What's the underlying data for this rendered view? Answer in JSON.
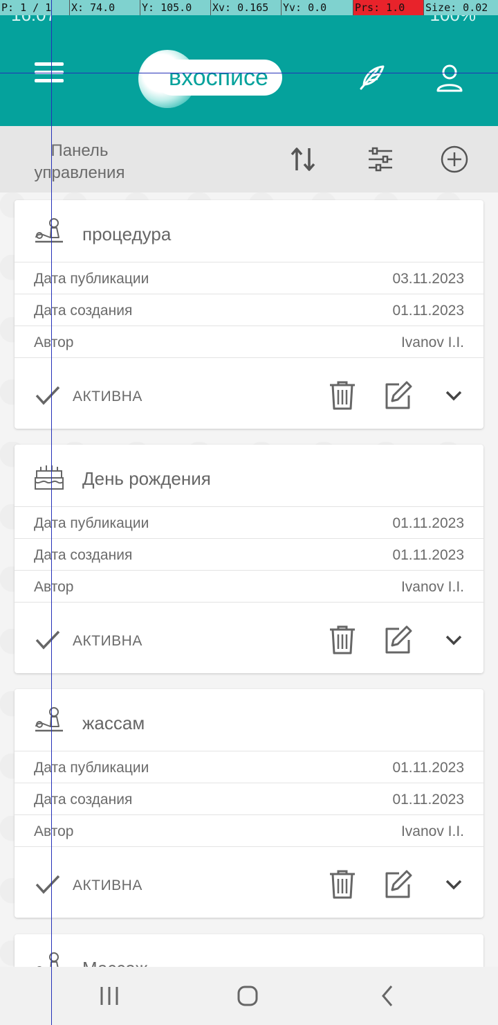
{
  "status_bar": {
    "time": "16:07",
    "battery": "100%",
    "debug": {
      "pointer": "P: 1 / 1",
      "x": "X: 74.0",
      "y": "Y: 105.0",
      "xv": "Xv: 0.165",
      "yv": "Yv: 0.0",
      "prs": "Prs: 1.0",
      "size": "Size: 0.02"
    }
  },
  "header": {
    "logo_text": "вхосписе",
    "icons": [
      "menu-icon",
      "feather-icon",
      "user-icon"
    ]
  },
  "toolbar": {
    "title": "Панель управления",
    "icons": [
      "sort-icon",
      "filter-icon",
      "add-icon"
    ]
  },
  "cards": [
    {
      "icon": "massage-icon",
      "title": "процедура",
      "rows": [
        {
          "label": "Дата публикации",
          "value": "03.11.2023"
        },
        {
          "label": "Дата создания",
          "value": "01.11.2023"
        },
        {
          "label": "Автор",
          "value": "Ivanov I.I."
        }
      ],
      "status": "АКТИВНА"
    },
    {
      "icon": "birthday-cake-icon",
      "title": "День рождения",
      "rows": [
        {
          "label": "Дата публикации",
          "value": "01.11.2023"
        },
        {
          "label": "Дата создания",
          "value": "01.11.2023"
        },
        {
          "label": "Автор",
          "value": "Ivanov I.I."
        }
      ],
      "status": "АКТИВНА"
    },
    {
      "icon": "massage-icon",
      "title": "жассам",
      "rows": [
        {
          "label": "Дата публикации",
          "value": "01.11.2023"
        },
        {
          "label": "Дата создания",
          "value": "01.11.2023"
        },
        {
          "label": "Автор",
          "value": "Ivanov I.I."
        }
      ],
      "status": "АКТИВНА"
    },
    {
      "icon": "massage-icon",
      "title": "Массаж"
    }
  ],
  "colors": {
    "brand": "#05a29c",
    "toolbar_bg": "#e6e6e6",
    "icon_gray": "#666666"
  },
  "nav": [
    "recent-apps-icon",
    "home-icon",
    "back-icon"
  ]
}
